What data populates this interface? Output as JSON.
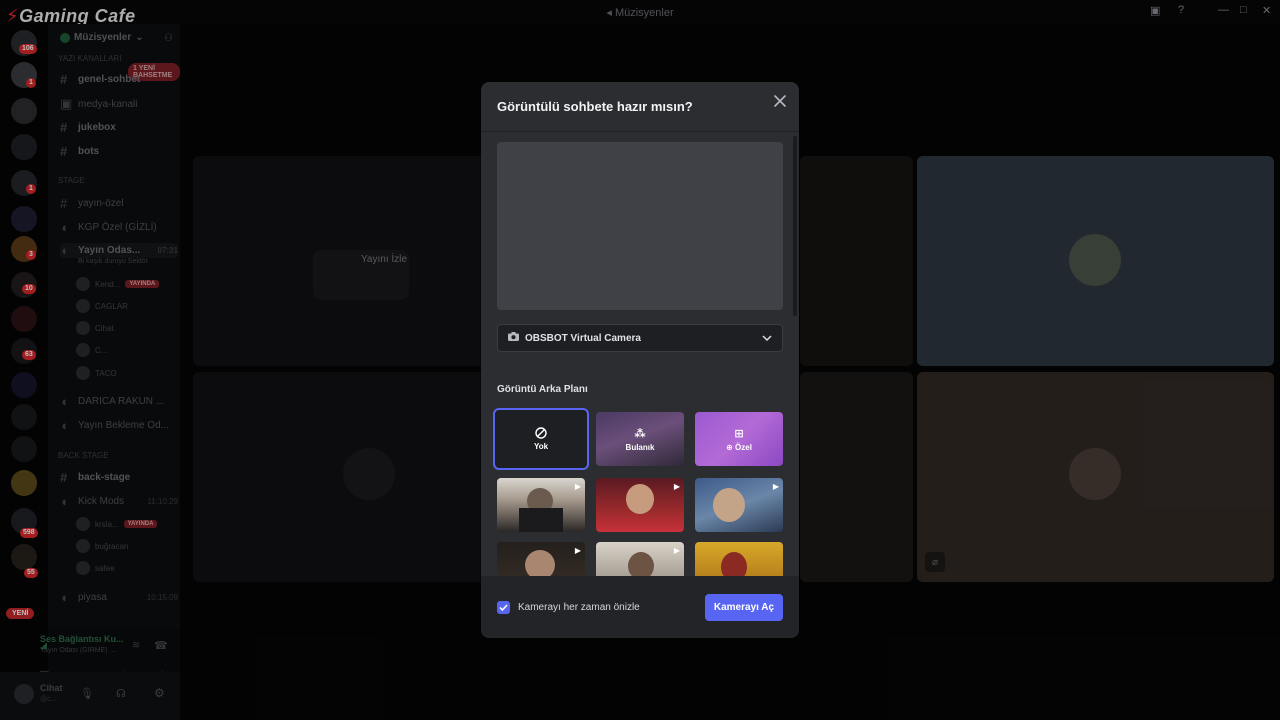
{
  "window": {
    "title": "Müzisyenler",
    "logo_text": "Gaming Cafe"
  },
  "guild_badges": [
    "106",
    "1",
    "1",
    "3",
    "10",
    "63",
    "598",
    "55"
  ],
  "guild_new_label": "YENİ",
  "sidebar": {
    "server_name": "Müzisyenler",
    "new_mention": "1 YENİ BAHSETME",
    "cat_text": "YAZI KANALLARI",
    "text_channels": [
      "genel-sohbet",
      "medya-kanali",
      "jukebox",
      "bots"
    ],
    "cat_stage": "STAGE",
    "stage_channels": [
      "yayın-özel",
      "KGP Özel (GİZLİ)"
    ],
    "voice_active": {
      "name": "Yayın Odas...",
      "time": "07:31",
      "status": "Bi kaşık duruyu Sektör"
    },
    "voice_users": [
      {
        "name": "Kend...",
        "live": "YAYINDA"
      },
      {
        "name": "CAGLAR",
        "live": ""
      },
      {
        "name": "Cihat",
        "live": ""
      },
      {
        "name": "C...",
        "live": ""
      },
      {
        "name": "TACO",
        "live": ""
      }
    ],
    "more_voice": [
      "DARICA RAKUN ...",
      "Yayın Bekleme Od..."
    ],
    "cat_back": "BACK STAGE",
    "back_channels": [
      {
        "name": "back-stage",
        "time": ""
      },
      {
        "name": "Kick Mods",
        "time": "11:10:29"
      }
    ],
    "back_users": [
      {
        "name": "krsla...",
        "live": "YAYINDA"
      },
      {
        "name": "buğracan",
        "live": ""
      },
      {
        "name": "safee",
        "live": ""
      }
    ],
    "piyasa": {
      "name": "piyasa",
      "time": "10:15:09"
    },
    "voice_status": {
      "title": "Ses Bağlantısı Ku...",
      "sub": "Yayın Odası (GİRME) ..."
    },
    "user": {
      "name": "Cihat",
      "status": "@c..."
    }
  },
  "stage": {
    "watch_label": "Yayını İzle"
  },
  "modal": {
    "title": "Görüntülü sohbete hazır mısın?",
    "camera": "OBSBOT Virtual Camera",
    "section_label": "Görüntü Arka Planı",
    "bg_options": [
      "Yok",
      "Bulanık",
      "Özel"
    ],
    "checkbox_label": "Kamerayı her zaman önizle",
    "checkbox_checked": true,
    "primary_button": "Kamerayı Aç"
  },
  "colors": {
    "accent": "#5865f2",
    "modal_bg": "#2b2d31",
    "live_red": "#d9282b"
  }
}
